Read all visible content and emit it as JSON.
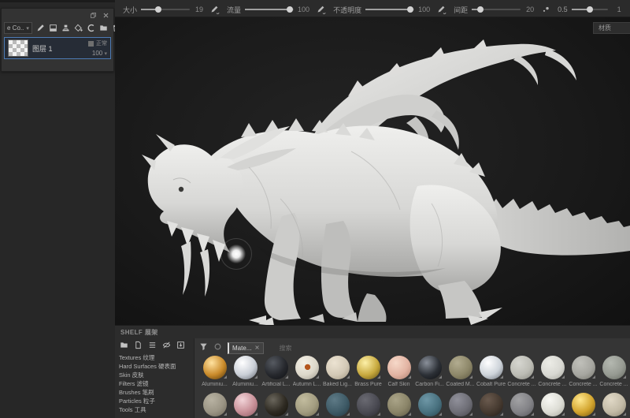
{
  "toolbar": {
    "sliders": [
      {
        "label": "大小",
        "value": "19",
        "fill": 35,
        "pen": true,
        "small": false
      },
      {
        "label": "流量",
        "value": "100",
        "fill": 92,
        "pen": true,
        "small": false
      },
      {
        "label": "不透明度",
        "value": "100",
        "fill": 92,
        "pen": true,
        "small": false
      },
      {
        "label": "间距",
        "value": "20",
        "fill": 18,
        "pen": false,
        "small": false
      },
      {
        "label": "0.5",
        "value": "1",
        "fill": 50,
        "pen": false,
        "small": true
      }
    ],
    "mode_icons": [
      "symmetry-icon",
      "projection-icon",
      "close-icon"
    ],
    "right_icons": [
      "display-mode-icon",
      "panel-toggle-icon"
    ]
  },
  "layers_panel": {
    "channel_dropdown": "e Co..",
    "window_icons": [
      "float-window-icon",
      "close-icon"
    ],
    "tool_icons": [
      "brush-icon",
      "fill-layer-icon",
      "stamp-icon",
      "bucket-add-icon",
      "smudge-icon",
      "folder-icon",
      "trash-icon"
    ],
    "layer": {
      "name": "图层 1",
      "blend": "正常",
      "opacity": "100"
    }
  },
  "viewport": {
    "right_tab": "材质"
  },
  "shelf": {
    "title": "SHELF 展架",
    "library_icons": [
      "folder-icon",
      "file-icon",
      "list-icon",
      "eye-off-icon",
      "import-icon"
    ],
    "filter_icon": "funnel-icon",
    "sync_icon": "ring-icon",
    "filter_chip": {
      "text": "Mate...",
      "close_icon": "close-icon"
    },
    "search_placeholder": "搜索",
    "categories": [
      {
        "en": "Textures",
        "zh": "纹理"
      },
      {
        "en": "Hard Surfaces",
        "zh": "硬表面"
      },
      {
        "en": "Skin",
        "zh": "皮肤"
      },
      {
        "en": "Filters",
        "zh": "滤镜"
      },
      {
        "en": "Brushes",
        "zh": "笔刷"
      },
      {
        "en": "Particles",
        "zh": "粒子"
      },
      {
        "en": "Tools",
        "zh": "工具"
      }
    ],
    "materials_row1": [
      {
        "name": "Aluminiu...",
        "hi": "#ffe2a0",
        "base": "#c98a2a",
        "dark": "#4a3008"
      },
      {
        "name": "Aluminiu...",
        "hi": "#ffffff",
        "base": "#c9ced6",
        "dark": "#5f646c"
      },
      {
        "name": "Artificial L...",
        "hi": "#565a61",
        "base": "#26282d",
        "dark": "#0e0f12"
      },
      {
        "name": "Autumn L...",
        "hi": "#f4f0e6",
        "base": "#ddd8ca",
        "dark": "#9a968a",
        "leaf": "#b4551c"
      },
      {
        "name": "Baked Lig...",
        "hi": "#ece3d2",
        "base": "#d3c9b6",
        "dark": "#9e9480"
      },
      {
        "name": "Brass Pure",
        "hi": "#fdf0a8",
        "base": "#c7a93e",
        "dark": "#5c4a10"
      },
      {
        "name": "Calf Skin",
        "hi": "#f6d9c9",
        "base": "#e2b3a2",
        "dark": "#a87a6a"
      },
      {
        "name": "Carbon Fi...",
        "hi": "#8a909a",
        "base": "#2c3036",
        "dark": "#0d0e11"
      },
      {
        "name": "Coated M...",
        "hi": "#b2ac90",
        "base": "#8d8769",
        "dark": "#5a553f"
      },
      {
        "name": "Cobalt Pure",
        "hi": "#ffffff",
        "base": "#cdd3d9",
        "dark": "#646a72"
      },
      {
        "name": "Concrete ...",
        "hi": "#d6d6d0",
        "base": "#bcbcb4",
        "dark": "#84847c"
      },
      {
        "name": "Concrete ...",
        "hi": "#ecece6",
        "base": "#d8d8d2",
        "dark": "#a2a29a"
      },
      {
        "name": "Concrete ...",
        "hi": "#c0c0ba",
        "base": "#a6a6a0",
        "dark": "#72726a"
      },
      {
        "name": "Concrete ...",
        "hi": "#b4b8b0",
        "base": "#969a92",
        "dark": "#62665e"
      }
    ],
    "materials_row2": [
      {
        "hi": "#b8b2a2",
        "base": "#9a9484",
        "dark": "#6a6456"
      },
      {
        "hi": "#f2d4d8",
        "base": "#c89098",
        "dark": "#8a5860"
      },
      {
        "hi": "#6a665c",
        "base": "#2e2a22",
        "dark": "#121008"
      },
      {
        "hi": "#c2bc9e",
        "base": "#a29c80",
        "dark": "#6e684e"
      },
      {
        "hi": "#5e7a86",
        "base": "#3e5a66",
        "dark": "#223640"
      },
      {
        "hi": "#6a6a72",
        "base": "#4a4a52",
        "dark": "#2a2a30"
      },
      {
        "hi": "#aaa488",
        "base": "#8a8468",
        "dark": "#585442"
      },
      {
        "hi": "#6e97a6",
        "base": "#49717f",
        "dark": "#27444f"
      },
      {
        "hi": "#90909a",
        "base": "#6e6e76",
        "dark": "#44444a"
      },
      {
        "hi": "#6a5a4e",
        "base": "#463a30",
        "dark": "#241c16"
      },
      {
        "hi": "#a2a2a4",
        "base": "#828286",
        "dark": "#54545a"
      },
      {
        "hi": "#f8f8f4",
        "base": "#dcdcd4",
        "dark": "#a6a69c"
      },
      {
        "hi": "#ffe88e",
        "base": "#d2a42e",
        "dark": "#6e500c"
      },
      {
        "hi": "#e0d8c6",
        "base": "#c2baa6",
        "dark": "#8a8270"
      }
    ]
  }
}
